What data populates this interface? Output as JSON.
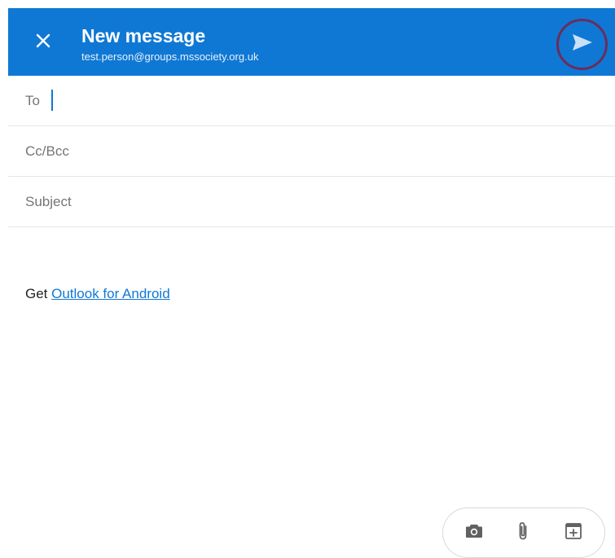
{
  "header": {
    "title": "New message",
    "account": "test.person@groups.mssociety.org.uk",
    "background": "#0f78d4",
    "close_icon": "close-icon",
    "send_icon": "send-icon",
    "send_highlight": "#6b2d5c"
  },
  "fields": {
    "to_label": "To",
    "cc_bcc_label": "Cc/Bcc",
    "subject_label": "Subject"
  },
  "body": {
    "prefix": "Get ",
    "link_text": "Outlook for Android",
    "link_color": "#0f78d4"
  },
  "toolbar": {
    "icons": [
      "camera-icon",
      "attachment-icon",
      "add-event-icon"
    ]
  }
}
